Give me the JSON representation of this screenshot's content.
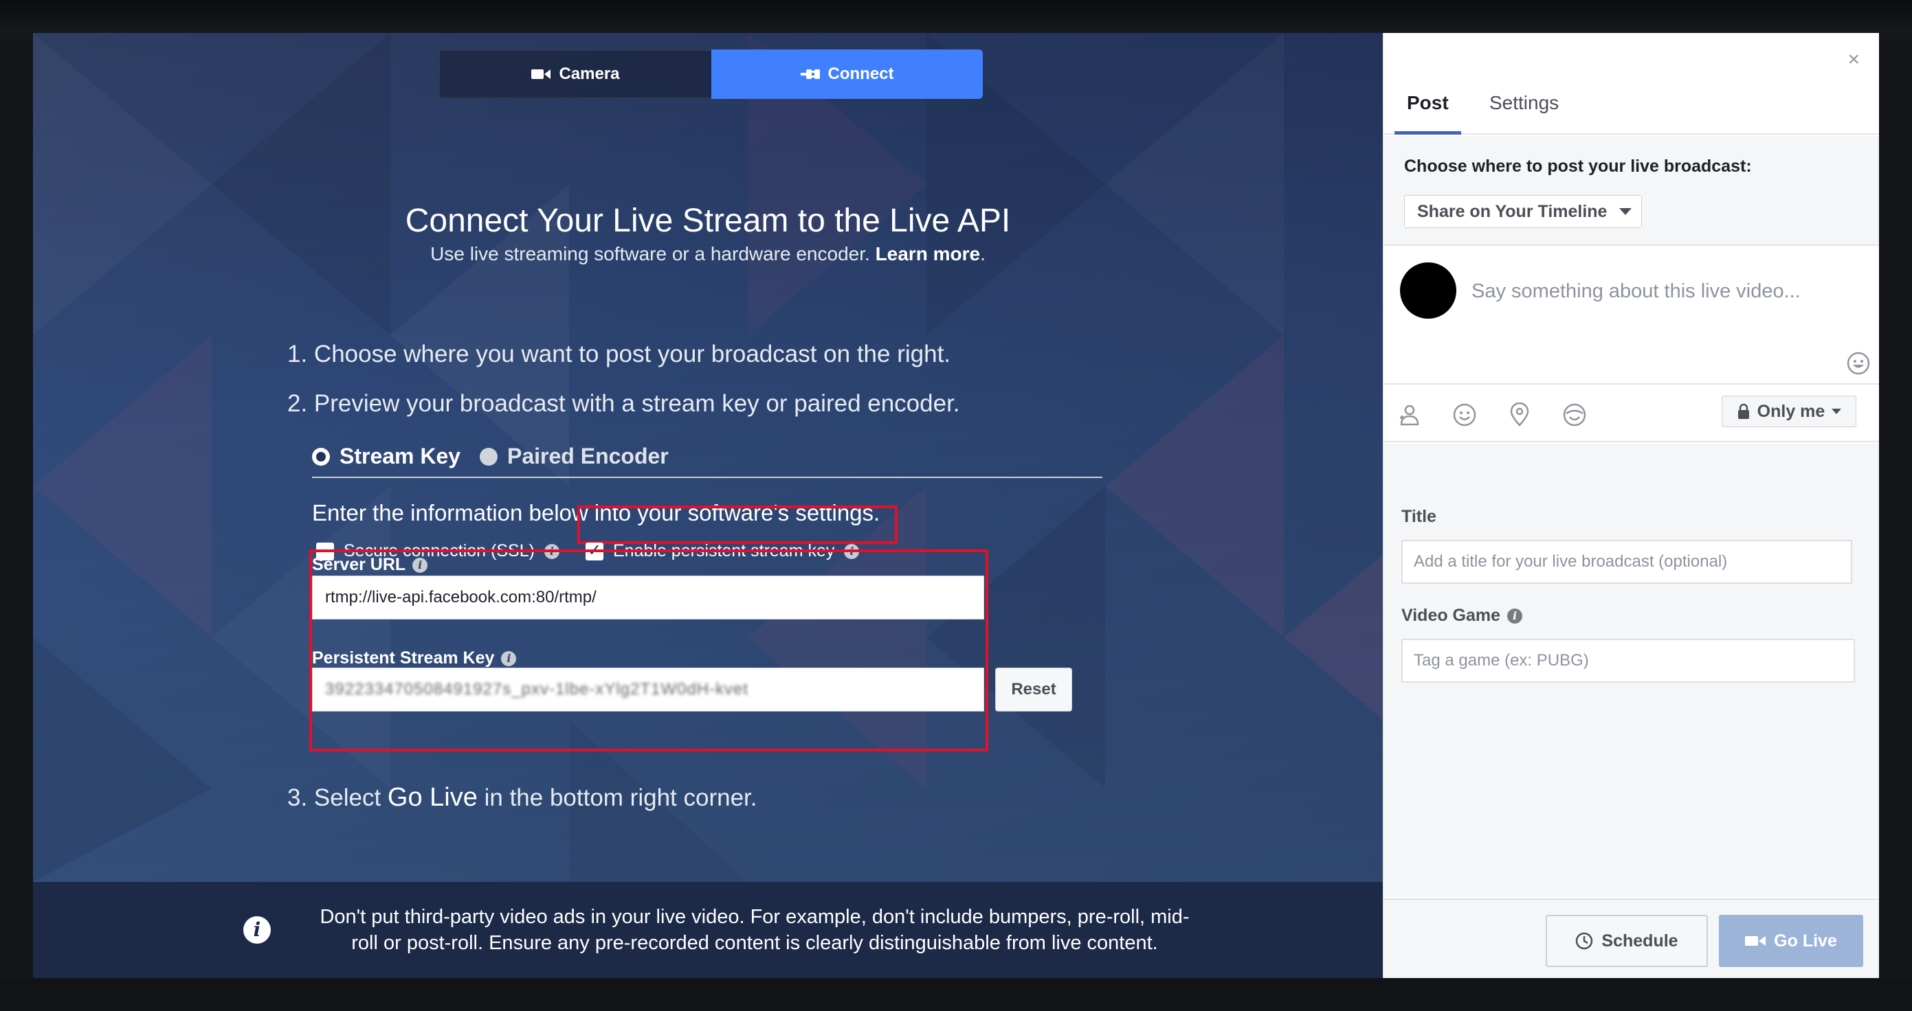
{
  "tabs_top": {
    "camera": "Camera",
    "connect": "Connect"
  },
  "main": {
    "title": "Connect Your Live Stream to the Live API",
    "subtitle": "Use live streaming software or a hardware encoder.",
    "learn_more": "Learn more",
    "subtitle_end": ".",
    "step1": "1. Choose where you want to post your broadcast on the right.",
    "step2": "2. Preview your broadcast with a stream key or paired encoder.",
    "step3_prefix": "3. Select ",
    "step3_emph": "Go Live",
    "step3_suffix": " in the bottom right corner.",
    "radio_stream_key": "Stream Key",
    "radio_paired_encoder": "Paired Encoder",
    "instructions": "Enter the information below into your software's settings.",
    "ssl_label": "Secure connection (SSL)",
    "persistent_label": "Enable persistent stream key",
    "server_url_label": "Server URL",
    "server_url_value": "rtmp://live-api.facebook.com:80/rtmp/",
    "stream_key_label": "Persistent Stream Key",
    "stream_key_value": "392233470508491927s_pxv-1lbe-xYlg2T1W0dH-kvet",
    "reset": "Reset",
    "info_glyph": "i"
  },
  "notice": {
    "line1": "Don't put third-party video ads in your live video. For example, don't include bumpers, pre-roll, mid-",
    "line2": "roll or post-roll. Ensure any pre-recorded content is clearly distinguishable from live content."
  },
  "sidebar": {
    "close": "×",
    "tab_post": "Post",
    "tab_settings": "Settings",
    "choose_label": "Choose where to post your live broadcast:",
    "destination": "Share on Your Timeline",
    "compose_placeholder": "Say something about this live video...",
    "privacy": "Only me",
    "title_label": "Title",
    "title_placeholder": "Add a title for your live broadcast (optional)",
    "game_label": "Video Game",
    "game_placeholder": "Tag a game (ex: PUBG)",
    "schedule": "Schedule",
    "go_live": "Go Live"
  },
  "colors": {
    "accent": "#4080ff",
    "highlight": "#e0112b",
    "golive_disabled": "#9cb4d8"
  },
  "icons": [
    "camera-icon",
    "plug-icon",
    "info-icon",
    "close-icon",
    "emoji-icon",
    "tag-people-icon",
    "feeling-icon",
    "location-icon",
    "sticker-icon",
    "lock-icon",
    "clock-icon",
    "video-camera-icon",
    "chevron-down-icon"
  ]
}
